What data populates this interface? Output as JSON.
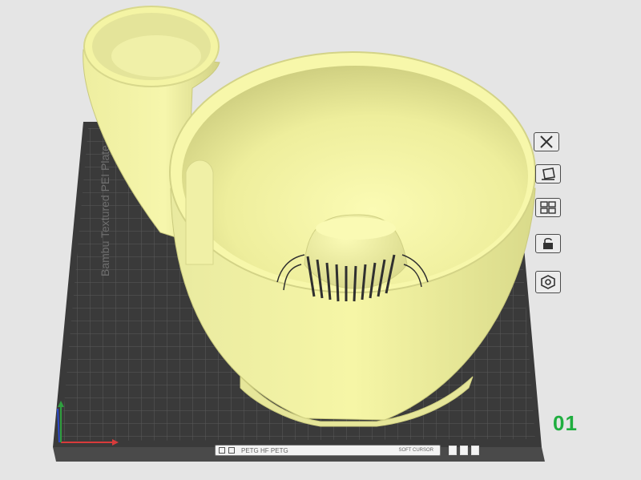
{
  "plate": {
    "name_text": "Bambu Textured PEI Plate",
    "number": "01"
  },
  "bottom_bar": {
    "object_name": "PETG HF PETG",
    "object_info": "SOFT CURSOR"
  },
  "colors": {
    "model": "#f2f29a",
    "plate": "#3b3b3b",
    "plate_number": "#1fae3f",
    "background": "#e5e5e5"
  },
  "icons": [
    "close-icon",
    "orient-icon",
    "arrange-icon",
    "lock-icon",
    "settings-icon"
  ]
}
